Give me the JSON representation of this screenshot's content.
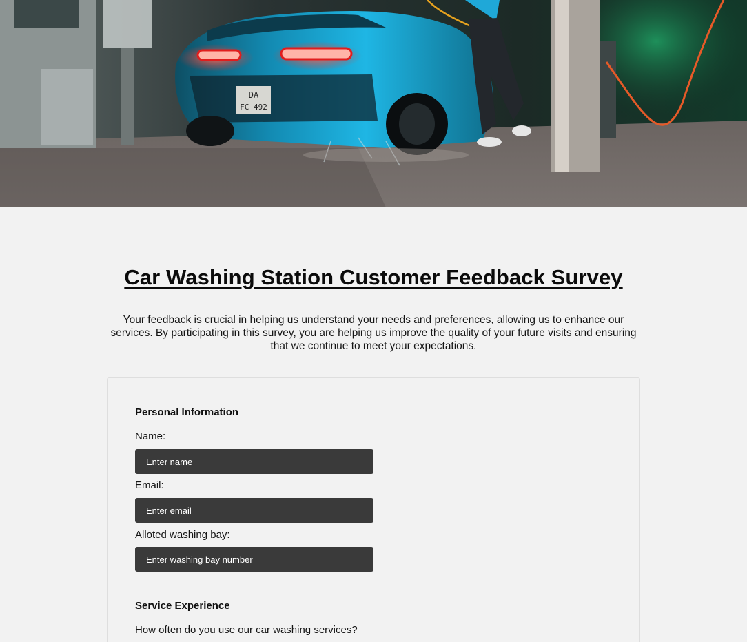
{
  "page": {
    "title": "Car Washing Station Customer Feedback Survey",
    "intro": "Your feedback is crucial in helping us understand your needs and preferences, allowing us to enhance our services. By participating in this survey, you are helping us improve the quality of your future visits and ensuring that we continue to meet your expectations."
  },
  "hero": {
    "icon": "car-wash-photo",
    "license_plate_line1": "DA",
    "license_plate_line2": "FC 492"
  },
  "personal_info": {
    "heading": "Personal Information",
    "name_label": "Name:",
    "name_placeholder": "Enter name",
    "name_value": "",
    "email_label": "Email:",
    "email_placeholder": "Enter email",
    "email_value": "",
    "bay_label": "Alloted washing bay:",
    "bay_placeholder": "Enter washing bay number",
    "bay_value": ""
  },
  "service_experience": {
    "heading": "Service Experience",
    "frequency_question": "How often do you use our car washing services?"
  },
  "colors": {
    "background": "#f2f2f2",
    "input_background": "#3a3a3a",
    "input_text": "#ffffff",
    "car_accent": "#1aa6d6",
    "taillight": "#ff3b3b"
  }
}
